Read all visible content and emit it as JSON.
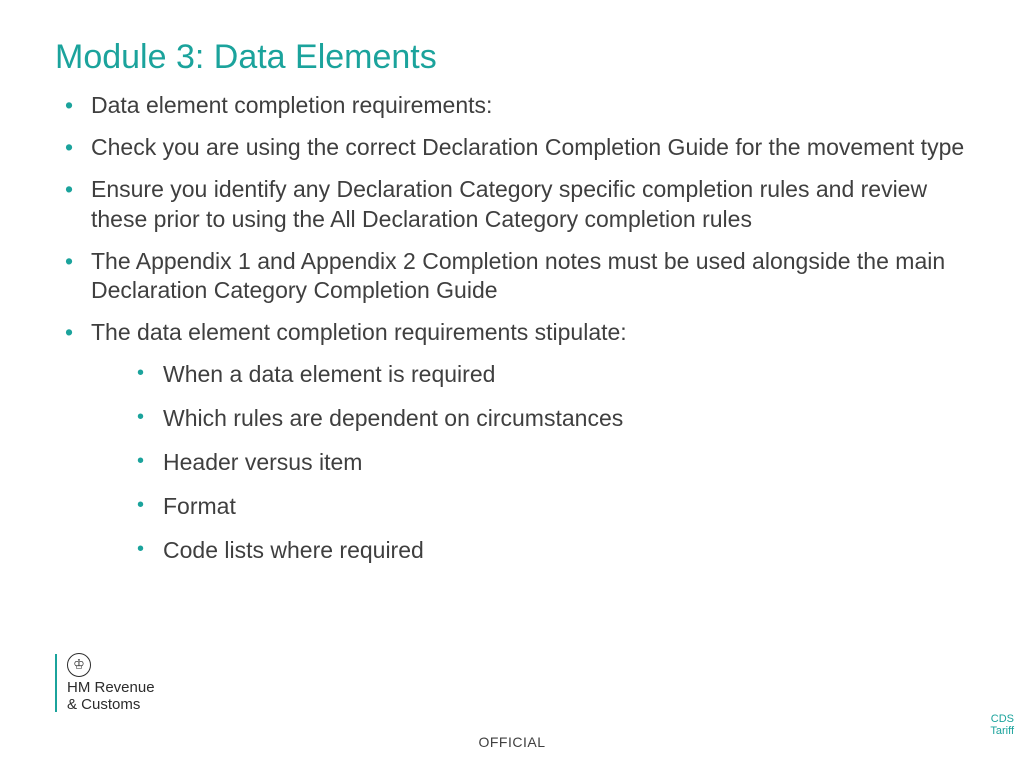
{
  "title": "Module 3: Data Elements",
  "bullets": {
    "b0": "Data element completion requirements:",
    "b1": "Check you are using the correct Declaration Completion Guide for the movement type",
    "b2": "Ensure you identify any Declaration Category specific completion rules and review these prior to using the All Declaration Category completion rules",
    "b3": "The Appendix 1 and Appendix 2 Completion notes must be used alongside the main Declaration Category Completion Guide",
    "b4": "The data element completion requirements stipulate:"
  },
  "sub": {
    "s0": "When a data element is required",
    "s1": "Which rules are dependent on circumstances",
    "s2": "Header versus item",
    "s3": "Format",
    "s4": "Code lists where required"
  },
  "logo": {
    "line1": "HM Revenue",
    "line2": "& Customs"
  },
  "classification": "OFFICIAL",
  "sidelabel": "CDS Tariff"
}
